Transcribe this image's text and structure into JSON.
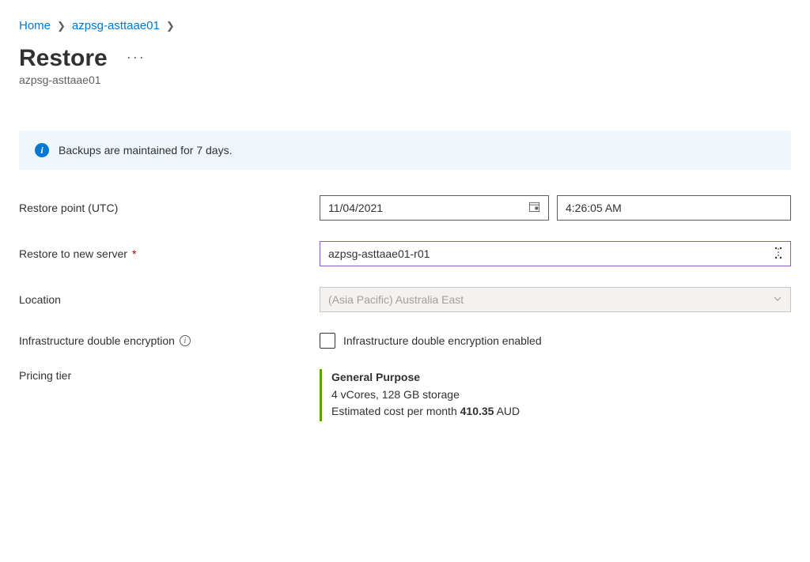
{
  "breadcrumb": {
    "home": "Home",
    "resource": "azpsg-asttaae01"
  },
  "page": {
    "title": "Restore",
    "subtitle": "azpsg-asttaae01"
  },
  "banner": {
    "text": "Backups are maintained for 7 days."
  },
  "form": {
    "restorePoint": {
      "label": "Restore point (UTC)",
      "date": "11/04/2021",
      "time": "4:26:05 AM"
    },
    "newServer": {
      "label": "Restore to new server",
      "value": "azpsg-asttaae01-r01"
    },
    "location": {
      "label": "Location",
      "value": "(Asia Pacific) Australia East"
    },
    "encryption": {
      "label": "Infrastructure double encryption",
      "checkboxLabel": "Infrastructure double encryption enabled"
    },
    "pricingTier": {
      "label": "Pricing tier",
      "tierName": "General Purpose",
      "specs": "4 vCores, 128 GB storage",
      "costPrefix": "Estimated cost per month ",
      "costValue": "410.35",
      "costSuffix": " AUD"
    }
  }
}
